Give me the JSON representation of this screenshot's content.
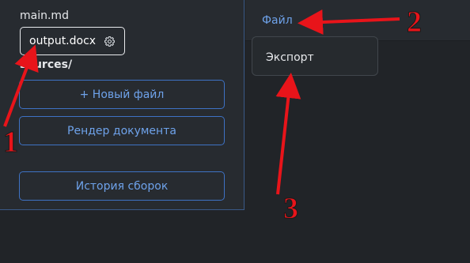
{
  "sidebar": {
    "files": [
      "main.md",
      "output.docx"
    ],
    "folder": "sources/",
    "buttons": {
      "new_file": "+ Новый файл",
      "render": "Рендер документа",
      "history": "История сборок"
    }
  },
  "menubar": {
    "file": "Файл"
  },
  "dropdown": {
    "items": [
      "Экспорт"
    ]
  },
  "annotations": {
    "labels": [
      "1",
      "2",
      "3"
    ],
    "color": "#e8141a"
  },
  "icons": {
    "settings": "gear-icon"
  },
  "colors": {
    "accent": "#6ea2ea",
    "border_accent": "#3e72c4"
  }
}
